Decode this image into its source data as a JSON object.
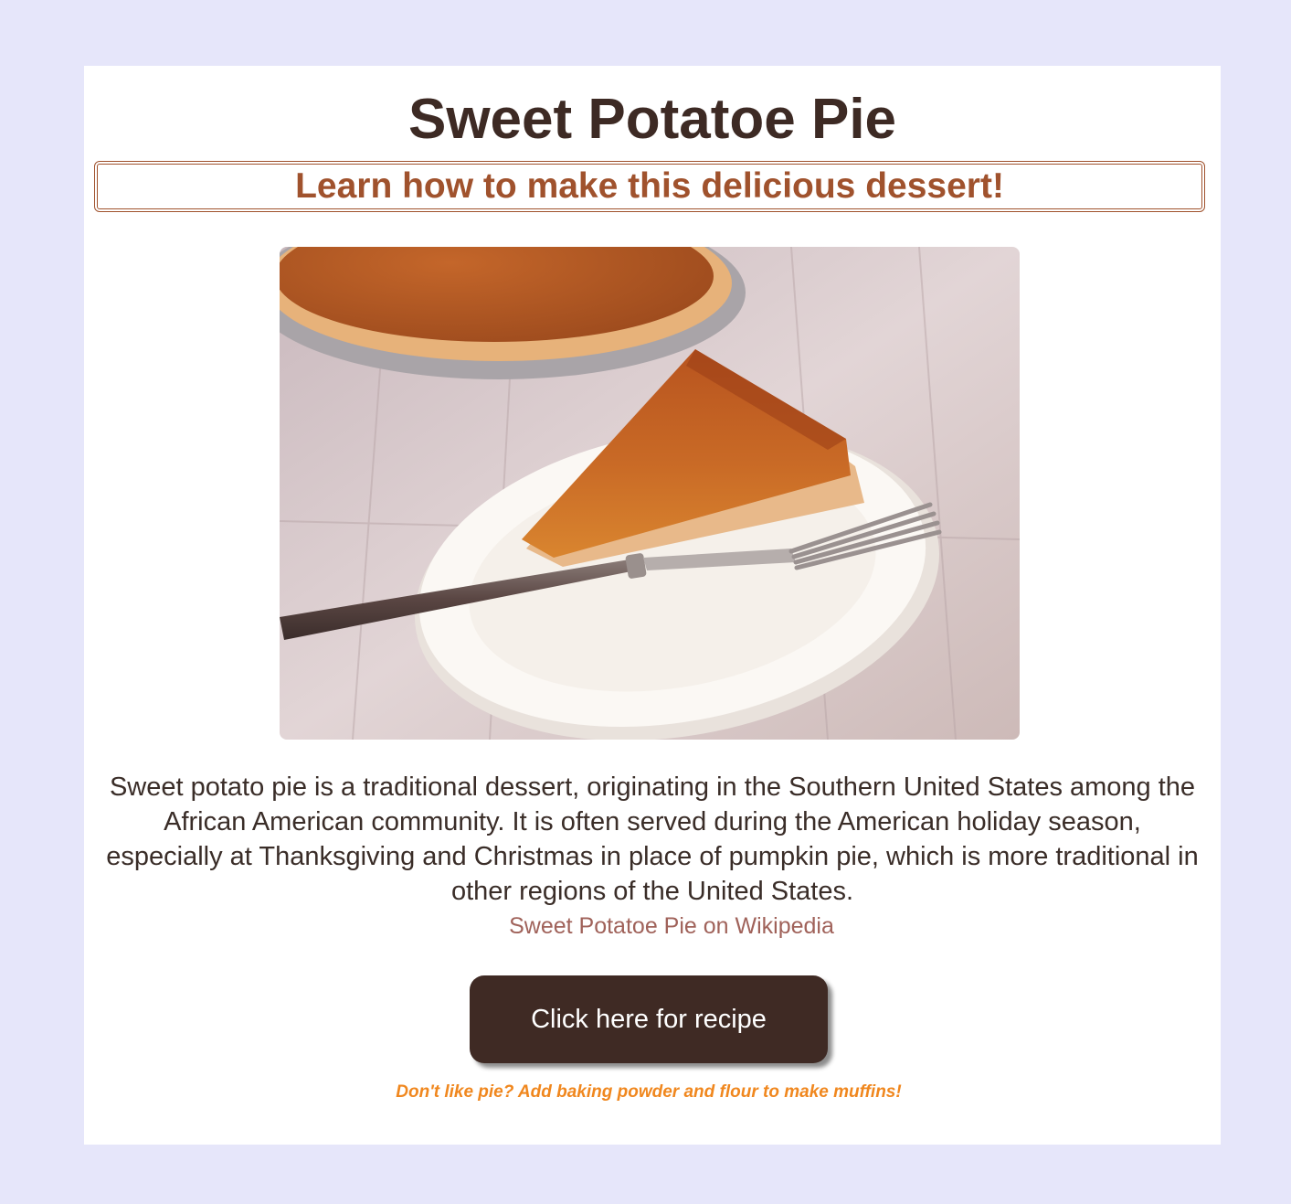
{
  "header": {
    "title": "Sweet Potatoe Pie",
    "subtitle": "Learn how to make this delicious dessert!"
  },
  "hero_image": {
    "alt": "Slice of sweet potato pie on a plate with a fork"
  },
  "main": {
    "description": "Sweet potato pie is a traditional dessert, originating in the Southern United States among the African American community. It is often served during the American holiday season, especially at Thanksgiving and Christmas in place of pumpkin pie, which is more traditional in other regions of the United States.",
    "wiki_link_label": "Sweet Potatoe Pie on Wikipedia",
    "recipe_button_label": "Click here for recipe",
    "muffin_note": "Don't like pie? Add baking powder and flour to make muffins!"
  },
  "colors": {
    "page_background": "#e6e6fa",
    "card_background": "#ffffff",
    "title": "#3d2a24",
    "subtitle": "#a0522d",
    "link": "#a0625a",
    "button": "#3f2a24",
    "note": "#f0871e"
  }
}
